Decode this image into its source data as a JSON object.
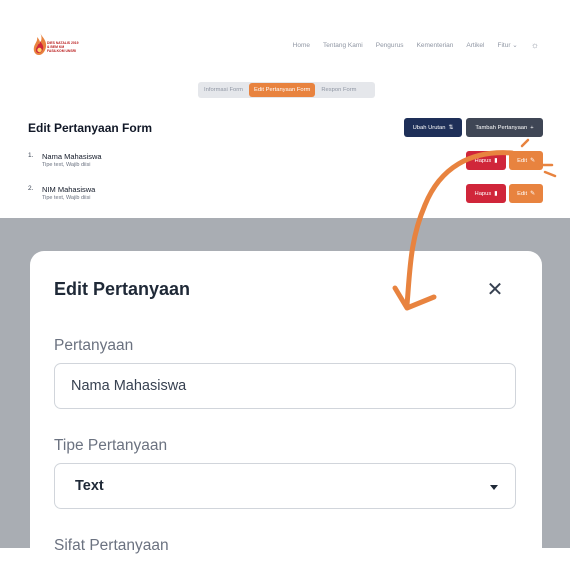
{
  "navbar": {
    "logo_text": [
      "DIES NATALIS 2019",
      "& BEM KM",
      "FASILKOM UNSRI"
    ],
    "links": [
      "Home",
      "Tentang Kami",
      "Pengurus",
      "Kementerian",
      "Artikel",
      "Fitur"
    ]
  },
  "tabs": [
    {
      "label": "Informasi Form",
      "active": false
    },
    {
      "label": "Edit Pertanyaan Form",
      "active": true
    },
    {
      "label": "Respon Form",
      "active": false
    }
  ],
  "page": {
    "title": "Edit Pertanyaan Form",
    "ubah_urutan_label": "Ubah Urutan",
    "tambah_label": "Tambah Pertanyaan"
  },
  "questions": [
    {
      "num": "1.",
      "text": "Nama Mahasiswa",
      "sub": "Tipe text, Wajib diisi",
      "hapus": "Hapus",
      "edit": "Edit"
    },
    {
      "num": "2.",
      "text": "NIM Mahasiswa",
      "sub": "Tipe text, Wajib diisi",
      "hapus": "Hapus",
      "edit": "Edit"
    }
  ],
  "modal": {
    "title": "Edit Pertanyaan",
    "pertanyaan_label": "Pertanyaan",
    "pertanyaan_value": "Nama Mahasiswa",
    "tipe_label": "Tipe Pertanyaan",
    "tipe_value": "Text",
    "sifat_label": "Sifat Pertanyaan"
  },
  "colors": {
    "accent": "#e8833f",
    "danger": "#d0263a",
    "navy": "#1e2f58",
    "dark": "#3f4655"
  }
}
